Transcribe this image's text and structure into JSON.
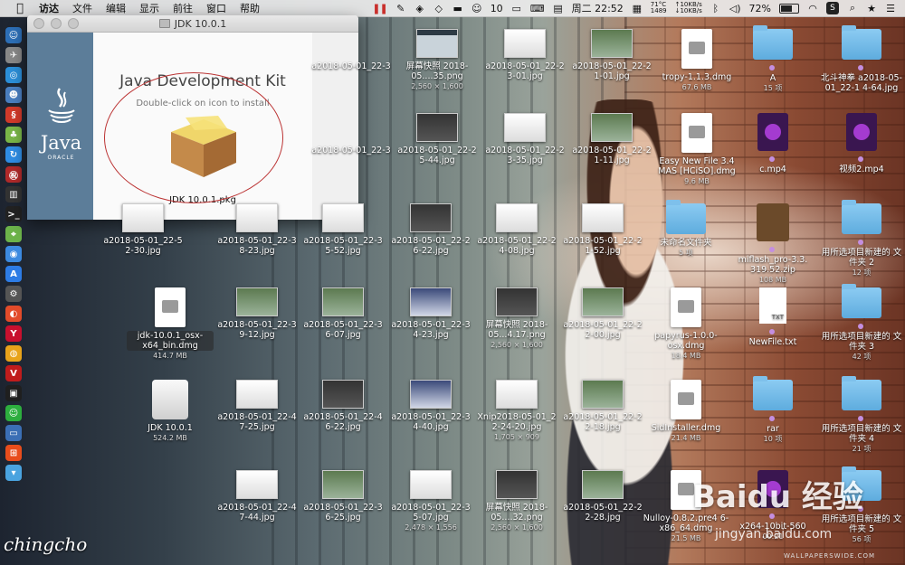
{
  "menubar": {
    "apple": "",
    "app_name": "访达",
    "menus": [
      "文件",
      "编辑",
      "显示",
      "前往",
      "窗口",
      "帮助"
    ],
    "status": {
      "wechat_count": "10",
      "clock": "周二 22:52",
      "temp": "71°C",
      "fan": "1489",
      "up": "↑10KB/s",
      "down": "↓10KB/s",
      "battery": "72%",
      "battery_level": 0.72
    }
  },
  "jdk_window": {
    "title": "JDK 10.0.1",
    "heading": "Java Development Kit",
    "instruction": "Double-click on icon to install",
    "package_label": "JDK 10.0.1.pkg",
    "logo_java": "Java",
    "logo_oracle": "ORACLE"
  },
  "desktop": {
    "row1": [
      {
        "label": "a2018-05-01_22-3",
        "sub": "",
        "kind": "partial"
      },
      {
        "label": "屏幕快照 2018-05....35.png",
        "sub": "2,560 × 1,600",
        "kind": "screen"
      },
      {
        "label": "a2018-05-01_22-2 3-01.jpg",
        "sub": "",
        "kind": "white"
      },
      {
        "label": "a2018-05-01_22-2 1-01.jpg",
        "sub": "",
        "kind": "green"
      },
      {
        "label": "tropy-1.1.3.dmg",
        "sub": "67.6 MB",
        "kind": "dmg"
      },
      {
        "label": "A",
        "sub": "15 项",
        "kind": "folder",
        "tag": true
      },
      {
        "label": "北斗神拳 a2018-05-01_22-1 4-64.jpg",
        "sub": "",
        "kind": "folder",
        "tag": true
      }
    ],
    "row2": [
      {
        "label": "a2018-05-01_22-3",
        "sub": "",
        "kind": "partial"
      },
      {
        "label": "a2018-05-01_22-2 5-44.jpg",
        "sub": "",
        "kind": "dark"
      },
      {
        "label": "a2018-05-01_22-2 3-35.jpg",
        "sub": "",
        "kind": "white"
      },
      {
        "label": "a2018-05-01_22-2 1-11.jpg",
        "sub": "",
        "kind": "green"
      },
      {
        "label": "Easy New File 3.4 MAS [HCiSO].dmg",
        "sub": "9.6 MB",
        "kind": "dmg"
      },
      {
        "label": "c.mp4",
        "sub": "",
        "kind": "video",
        "tag": true
      },
      {
        "label": "视频2.mp4",
        "sub": "",
        "kind": "video",
        "tag": true
      }
    ],
    "row3": [
      {
        "label": "a2018-05-01_22-5 2-30.jpg",
        "sub": "",
        "kind": "white"
      },
      {
        "label": "a2018-05-01_22-3 8-23.jpg",
        "sub": "",
        "kind": "white"
      },
      {
        "label": "a2018-05-01_22-3 5-52.jpg",
        "sub": "",
        "kind": "white"
      },
      {
        "label": "a2018-05-01_22-2 6-22.jpg",
        "sub": "",
        "kind": "dark"
      },
      {
        "label": "a2018-05-01_22-2 4-08.jpg",
        "sub": "",
        "kind": "white"
      },
      {
        "label": "a2018-05-01_22-2 1-52.jpg",
        "sub": "",
        "kind": "white"
      },
      {
        "label": "未命名文件夹",
        "sub": "5 项",
        "kind": "folder"
      },
      {
        "label": "miflash_pro-3.3. 319.52.zip",
        "sub": "108 MB",
        "kind": "zip",
        "tag": true
      },
      {
        "label": "用所选项目新建的 文件夹 2",
        "sub": "12 项",
        "kind": "folder",
        "tag": true
      }
    ],
    "row4": [
      {
        "label": "jdk-10.0.1_osx- x64_bin.dmg",
        "sub": "414.7 MB",
        "kind": "dmg",
        "selected": true
      },
      {
        "label": "a2018-05-01_22-3 9-12.jpg",
        "sub": "",
        "kind": "green"
      },
      {
        "label": "a2018-05-01_22-3 6-07.jpg",
        "sub": "",
        "kind": "green"
      },
      {
        "label": "a2018-05-01_22-3 4-23.jpg",
        "sub": "",
        "kind": "blue"
      },
      {
        "label": "屏幕快照 2018-05...4.17.png",
        "sub": "2,560 × 1,600",
        "kind": "dark"
      },
      {
        "label": "a2018-05-01_22-2 2-00.jpg",
        "sub": "",
        "kind": "green"
      },
      {
        "label": "papyrus-1.0.0- osx.dmg",
        "sub": "18.4 MB",
        "kind": "dmg"
      },
      {
        "label": "NewFile.txt",
        "sub": "",
        "kind": "txt",
        "tag": true
      },
      {
        "label": "用所选项目新建的 文件夹 3",
        "sub": "42 项",
        "kind": "folder",
        "tag": true
      }
    ],
    "row5": [
      {
        "label": "JDK 10.0.1",
        "sub": "524.2 MB",
        "kind": "drive"
      },
      {
        "label": "a2018-05-01_22-4 7-25.jpg",
        "sub": "",
        "kind": "white"
      },
      {
        "label": "a2018-05-01_22-4 6-22.jpg",
        "sub": "",
        "kind": "dark"
      },
      {
        "label": "a2018-05-01_22-3 4-40.jpg",
        "sub": "",
        "kind": "blue"
      },
      {
        "label": "Xnip2018-05-01_2 2-24-20.jpg",
        "sub": "1,705 × 909",
        "kind": "white"
      },
      {
        "label": "a2018-05-01_22-2 2-18.jpg",
        "sub": "",
        "kind": "green"
      },
      {
        "label": "SidInstaller.dmg",
        "sub": "21.4 MB",
        "kind": "dmg"
      },
      {
        "label": "rar",
        "sub": "10 项",
        "kind": "folder",
        "tag": true
      },
      {
        "label": "用所选项目新建的 文件夹 4",
        "sub": "21 项",
        "kind": "folder",
        "tag": true
      }
    ],
    "row6": [
      {
        "label": "a2018-05-01_22-4 7-44.jpg",
        "sub": "",
        "kind": "white"
      },
      {
        "label": "a2018-05-01_22-3 6-25.jpg",
        "sub": "",
        "kind": "green"
      },
      {
        "label": "a2018-05-01_22-3 5-07.jpg",
        "sub": "2,478 × 1,556",
        "kind": "white"
      },
      {
        "label": "屏幕快照 2018-05....32.png",
        "sub": "2,560 × 1,600",
        "kind": "dark"
      },
      {
        "label": "a2018-05-01_22-2 2-28.jpg",
        "sub": "",
        "kind": "green"
      },
      {
        "label": "Nulloy-0.8.2.pre4 6-x86_64.dmg",
        "sub": "21.5 MB",
        "kind": "dmg"
      },
      {
        "label": "x264-10bit-560",
        "sub": "00:21",
        "kind": "video",
        "tag": true
      },
      {
        "label": "用所选项目新建的 文件夹 5",
        "sub": "56 项",
        "kind": "folder",
        "tag": true
      }
    ]
  },
  "watermarks": {
    "signature": "chingcho",
    "baidu": "Baidu 经验",
    "baidu_url": "jingyan.baidu.com",
    "wallpaper": "WALLPAPERSWIDE.COM"
  },
  "colors": {
    "sidebar": "#5c7d99",
    "annotation": "#bb3333",
    "tag_purple": "#c48ee0"
  }
}
